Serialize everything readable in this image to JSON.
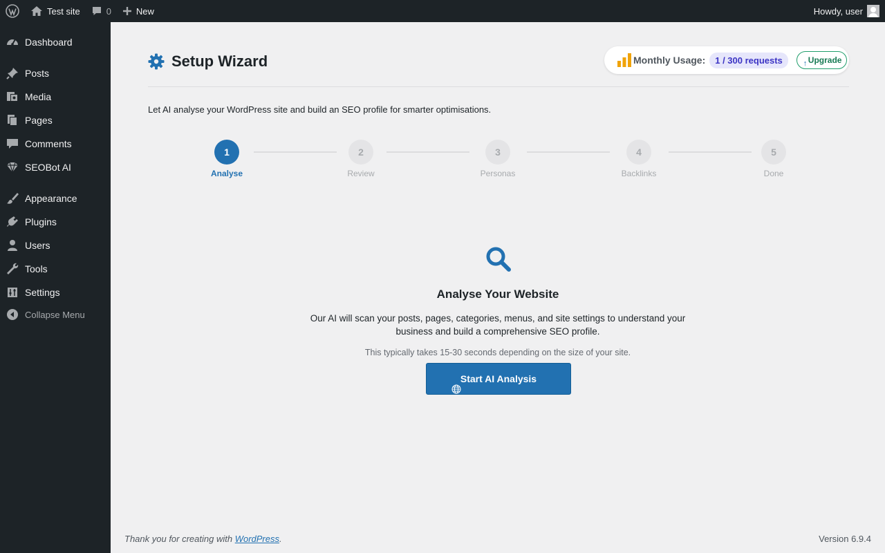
{
  "admin_bar": {
    "site_name": "Test site",
    "comments_count": "0",
    "new_label": "New",
    "greeting": "Howdy, user"
  },
  "sidebar": {
    "items": [
      {
        "label": "Dashboard",
        "icon": "dashboard-icon"
      },
      {
        "label": "Posts",
        "icon": "pin-icon"
      },
      {
        "label": "Media",
        "icon": "media-icon"
      },
      {
        "label": "Pages",
        "icon": "pages-icon"
      },
      {
        "label": "Comments",
        "icon": "comment-icon"
      },
      {
        "label": "SEOBot AI",
        "icon": "diamond-icon"
      },
      {
        "label": "Appearance",
        "icon": "brush-icon"
      },
      {
        "label": "Plugins",
        "icon": "plug-icon"
      },
      {
        "label": "Users",
        "icon": "user-icon"
      },
      {
        "label": "Tools",
        "icon": "wrench-icon"
      },
      {
        "label": "Settings",
        "icon": "sliders-icon"
      }
    ],
    "collapse_label": "Collapse Menu"
  },
  "page": {
    "title": "Setup Wizard",
    "intro": "Let AI analyse your WordPress site and build an SEO profile for smarter optimisations.",
    "usage": {
      "label": "Monthly Usage:",
      "count": "1 / 300 requests",
      "upgrade_label": "Upgrade"
    },
    "steps": [
      {
        "number": "1",
        "label": "Analyse",
        "active": true
      },
      {
        "number": "2",
        "label": "Review",
        "active": false
      },
      {
        "number": "3",
        "label": "Personas",
        "active": false
      },
      {
        "number": "4",
        "label": "Backlinks",
        "active": false
      },
      {
        "number": "5",
        "label": "Done",
        "active": false
      }
    ],
    "analyse": {
      "title": "Analyse Your Website",
      "description": "Our AI will scan your posts, pages, categories, menus, and site settings to understand your business and build a comprehensive SEO profile.",
      "note": "This typically takes 15-30 seconds depending on the size of your site.",
      "button_label": "Start AI Analysis"
    }
  },
  "footer": {
    "thanks_prefix": "Thank you for creating with ",
    "thanks_link": "WordPress",
    "thanks_suffix": ".",
    "version": "Version 6.9.4"
  },
  "colors": {
    "admin_dark": "#1d2327",
    "primary": "#2271b1",
    "usage_bar_orange": "#f0a30a",
    "upgrade_green": "#1f9d6b"
  }
}
